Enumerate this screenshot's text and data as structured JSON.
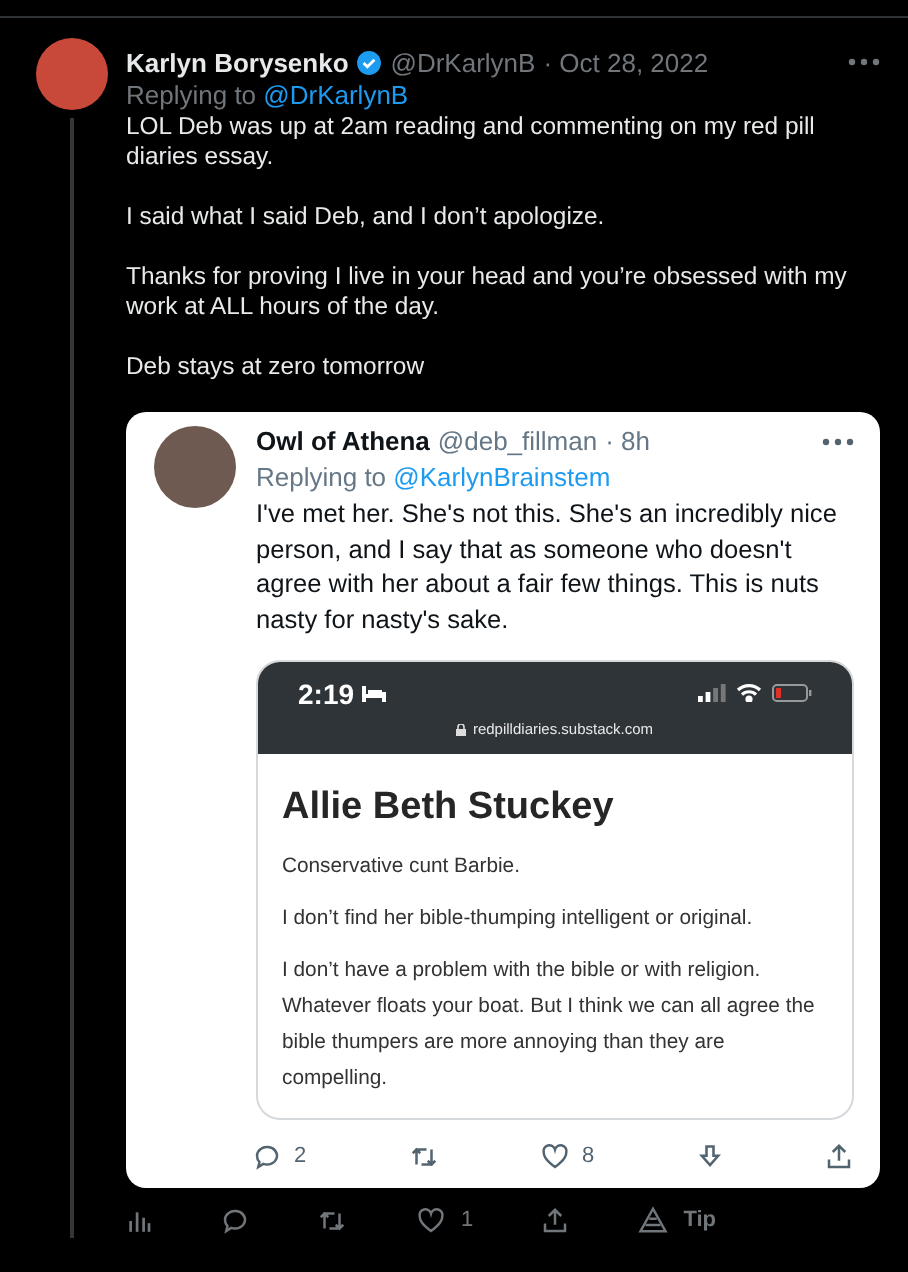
{
  "tweet": {
    "author": "Karlyn Borysenko",
    "verified": true,
    "handle": "@DrKarlynB",
    "date": "· Oct 28, 2022",
    "replying_label": "Replying to",
    "replying_to": "@DrKarlynB",
    "paragraphs": [
      "LOL Deb was up at 2am reading and commenting on my red pill diaries essay.",
      "I said what I said Deb, and I don’t apologize.",
      "Thanks for proving I live in your head and you’re obsessed with my work at ALL hours of the day.",
      "Deb stays at zero tomorrow"
    ],
    "quoted": {
      "author": "Owl of Athena",
      "handle": "@deb_fillman",
      "time": "· 8h",
      "replying_label": "Replying to",
      "replying_to": "@KarlynBrainstem",
      "text": "I've met her. She's not this. She's an incredibly nice person, and I say that as someone who doesn't agree with her about a fair few things. This is nuts nasty for nasty's sake.",
      "screenshot": {
        "time": "2:19",
        "url": "redpilldiaries.substack.com",
        "title": "Allie Beth Stuckey",
        "paragraphs": [
          "Conservative cunt Barbie.",
          "I don’t find her bible-thumping intelligent or original.",
          "I don’t have a problem with the bible or with religion. Whatever floats your boat. But I think we can all agree the bible thumpers are more annoying than they are compelling."
        ]
      },
      "actions": [
        {
          "kind": "reply",
          "count": "2"
        },
        {
          "kind": "retweet"
        },
        {
          "kind": "like",
          "count": "8"
        },
        {
          "kind": "download"
        },
        {
          "kind": "share"
        }
      ]
    },
    "actions": [
      {
        "kind": "stats"
      },
      {
        "kind": "reply"
      },
      {
        "kind": "retweet"
      },
      {
        "kind": "like",
        "count": "1"
      },
      {
        "kind": "share"
      },
      {
        "kind": "tip",
        "label": "Tip"
      }
    ]
  }
}
